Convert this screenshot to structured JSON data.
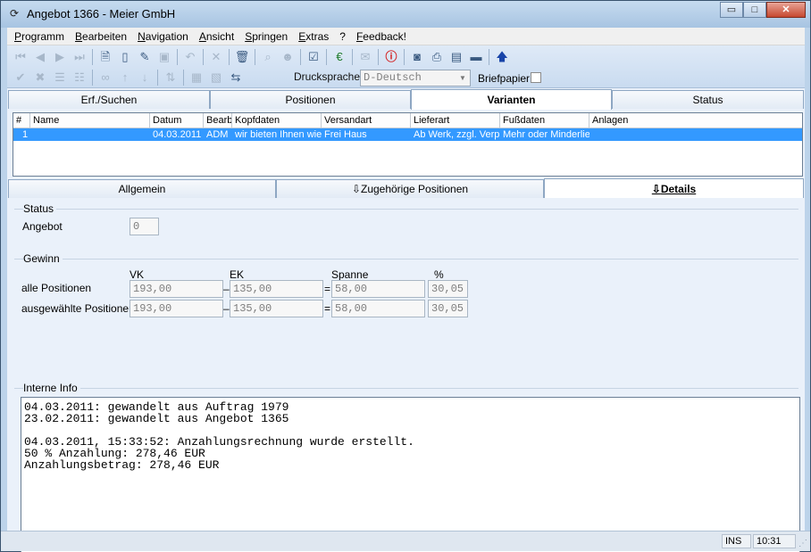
{
  "window": {
    "title": "Angebot 1366 - Meier GmbH",
    "controls": {
      "minimize": "▭",
      "maximize": "□",
      "close": "✕"
    }
  },
  "menu": [
    "Programm",
    "Bearbeiten",
    "Navigation",
    "Ansicht",
    "Springen",
    "Extras",
    "?",
    "Feedback!"
  ],
  "toolbar": {
    "druck_label": "Drucksprache",
    "druck_value": "D-Deutsch",
    "brief_label": "Briefpapier",
    "brief_checked": false
  },
  "tabs": [
    "Erf./Suchen",
    "Positionen",
    "Varianten",
    "Status"
  ],
  "active_tab": "Varianten",
  "grid": {
    "columns": [
      "#",
      "Name",
      "Datum",
      "Bearb",
      "Kopfdaten",
      "Versandart",
      "Lieferart",
      "Fußdaten",
      "Anlagen"
    ],
    "rows": [
      [
        "1",
        "",
        "04.03.2011",
        "ADM",
        "wir bieten Ihnen wie",
        "Frei Haus",
        "Ab Werk, zzgl. Verp",
        "Mehr oder Minderlie",
        ""
      ]
    ]
  },
  "subtabs": [
    "Allgemein",
    "Zugehörige Positionen",
    "Details"
  ],
  "active_subtab": "Details",
  "details": {
    "status_title": "Status",
    "angebot_label": "Angebot",
    "angebot_value": "0",
    "gewinn_title": "Gewinn",
    "col_vk": "VK",
    "col_ek": "EK",
    "col_spanne": "Spanne",
    "col_pct": "%",
    "row1_label": "alle Positionen",
    "row2_label": "ausgewählte Positionen",
    "row1": {
      "vk": "193,00",
      "ek": "135,00",
      "spanne": "58,00",
      "pct": "30,05"
    },
    "row2": {
      "vk": "193,00",
      "ek": "135,00",
      "spanne": "58,00",
      "pct": "30,05"
    },
    "minus": "–",
    "equals": "=",
    "info_title": "Interne Info",
    "info_text": "04.03.2011: gewandelt aus Auftrag 1979\n23.02.2011: gewandelt aus Angebot 1365\n\n04.03.2011, 15:33:52: Anzahlungsrechnung wurde erstellt.\n50 % Anzahlung: 278,46 EUR\nAnzahlungsbetrag: 278,46 EUR"
  },
  "statusbar": {
    "mode": "INS",
    "time": "10:31"
  }
}
